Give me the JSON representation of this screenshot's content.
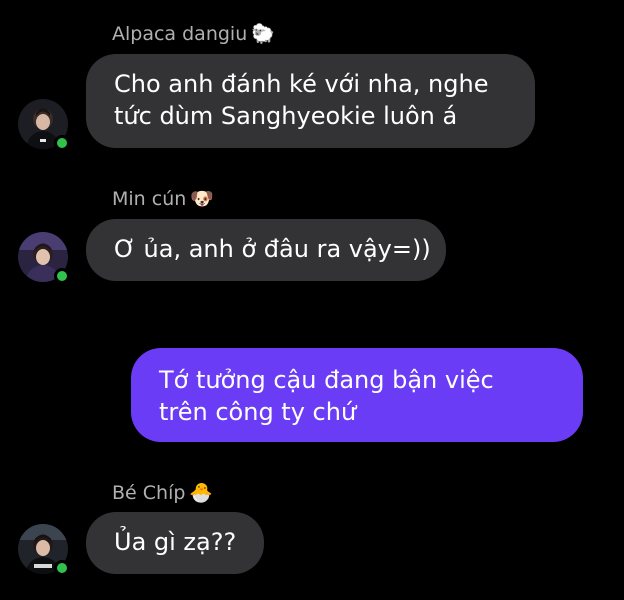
{
  "messages": [
    {
      "sender": "Alpaca dangiu",
      "sender_emoji": "🐑",
      "lines": [
        "Cho anh đánh ké với nha, nghe",
        "tức dùm Sanghyeokie luôn á"
      ]
    },
    {
      "sender": "Min cún",
      "sender_emoji": "🐶",
      "lines": [
        "Ơ ủa, anh ở đâu ra vậy=))"
      ]
    },
    {
      "sender": "",
      "outgoing": true,
      "lines": [
        "Tớ tưởng cậu đang bận việc",
        "trên công ty chứ"
      ]
    },
    {
      "sender": "Bé Chíp",
      "sender_emoji": "🐣",
      "lines": [
        "Ủa gì zạ??"
      ]
    }
  ],
  "colors": {
    "background": "#000000",
    "incoming_bubble": "#333335",
    "outgoing_bubble": "#6b3cf6",
    "online_dot": "#31c24d",
    "sender_name": "#b0b0b0"
  }
}
